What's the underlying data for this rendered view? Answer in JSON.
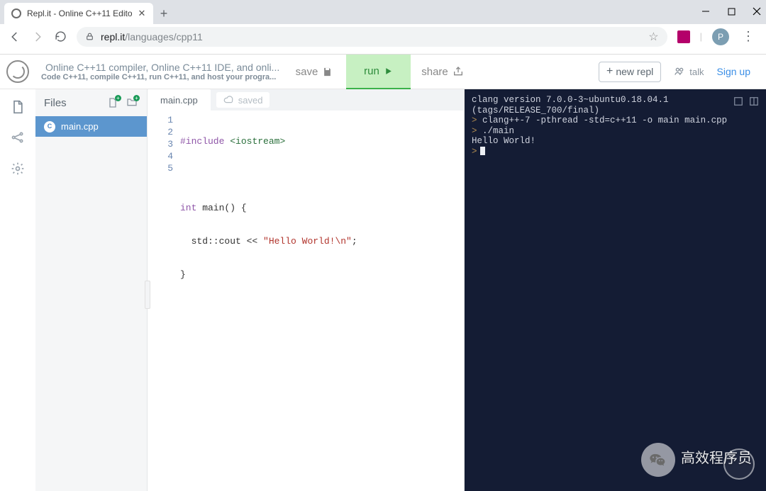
{
  "browser": {
    "tab_title": "Repl.it - Online C++11 Editor",
    "url_host": "repl.it",
    "url_path": "/languages/cpp11",
    "profile_letter": "P"
  },
  "header": {
    "title": "Online C++11 compiler, Online C++11 IDE, and onli...",
    "subtitle": "Code C++11, compile C++11, run C++11, and host your progra...",
    "save_label": "save",
    "run_label": "run",
    "share_label": "share",
    "new_repl_label": "new repl",
    "talk_label": "talk",
    "sign_up_label": "Sign up"
  },
  "files": {
    "panel_title": "Files",
    "items": [
      {
        "name": "main.cpp"
      }
    ]
  },
  "editor": {
    "active_tab": "main.cpp",
    "saved_status": "saved",
    "lines": [
      1,
      2,
      3,
      4,
      5
    ],
    "code": {
      "l1_kw": "#include",
      "l1_inc": "<iostream>",
      "l3_kw": "int",
      "l3_rest": " main() {",
      "l4_pre": "  std::cout << ",
      "l4_str": "\"Hello World!\\n\"",
      "l4_post": ";",
      "l5": "}"
    }
  },
  "terminal": {
    "lines": [
      "clang version 7.0.0-3~ubuntu0.18.04.1 (tags/RELEASE_700/final)",
      "clang++-7 -pthread -std=c++11 -o main main.cpp",
      "./main",
      "Hello World!"
    ],
    "prompt": ">"
  },
  "watermark": {
    "text": "高效程序员"
  }
}
